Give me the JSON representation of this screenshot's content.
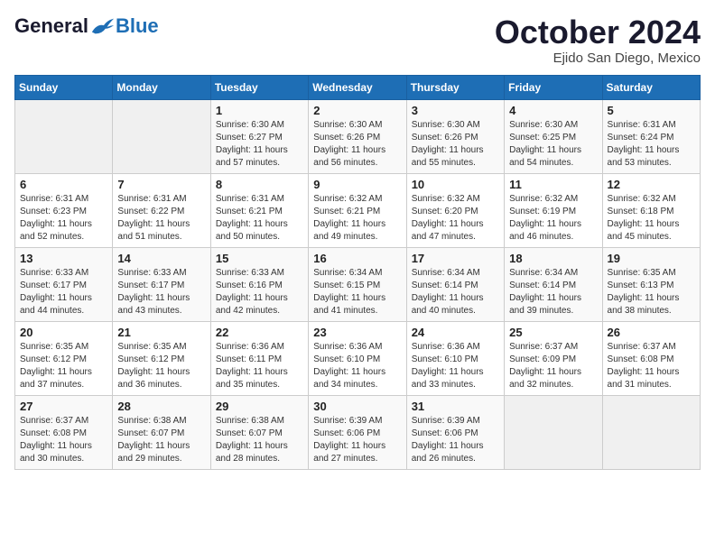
{
  "header": {
    "logo": {
      "general": "General",
      "blue": "Blue"
    },
    "title": "October 2024",
    "location": "Ejido San Diego, Mexico"
  },
  "weekdays": [
    "Sunday",
    "Monday",
    "Tuesday",
    "Wednesday",
    "Thursday",
    "Friday",
    "Saturday"
  ],
  "weeks": [
    [
      {
        "day": "",
        "info": ""
      },
      {
        "day": "",
        "info": ""
      },
      {
        "day": "1",
        "info": "Sunrise: 6:30 AM\nSunset: 6:27 PM\nDaylight: 11 hours and 57 minutes."
      },
      {
        "day": "2",
        "info": "Sunrise: 6:30 AM\nSunset: 6:26 PM\nDaylight: 11 hours and 56 minutes."
      },
      {
        "day": "3",
        "info": "Sunrise: 6:30 AM\nSunset: 6:26 PM\nDaylight: 11 hours and 55 minutes."
      },
      {
        "day": "4",
        "info": "Sunrise: 6:30 AM\nSunset: 6:25 PM\nDaylight: 11 hours and 54 minutes."
      },
      {
        "day": "5",
        "info": "Sunrise: 6:31 AM\nSunset: 6:24 PM\nDaylight: 11 hours and 53 minutes."
      }
    ],
    [
      {
        "day": "6",
        "info": "Sunrise: 6:31 AM\nSunset: 6:23 PM\nDaylight: 11 hours and 52 minutes."
      },
      {
        "day": "7",
        "info": "Sunrise: 6:31 AM\nSunset: 6:22 PM\nDaylight: 11 hours and 51 minutes."
      },
      {
        "day": "8",
        "info": "Sunrise: 6:31 AM\nSunset: 6:21 PM\nDaylight: 11 hours and 50 minutes."
      },
      {
        "day": "9",
        "info": "Sunrise: 6:32 AM\nSunset: 6:21 PM\nDaylight: 11 hours and 49 minutes."
      },
      {
        "day": "10",
        "info": "Sunrise: 6:32 AM\nSunset: 6:20 PM\nDaylight: 11 hours and 47 minutes."
      },
      {
        "day": "11",
        "info": "Sunrise: 6:32 AM\nSunset: 6:19 PM\nDaylight: 11 hours and 46 minutes."
      },
      {
        "day": "12",
        "info": "Sunrise: 6:32 AM\nSunset: 6:18 PM\nDaylight: 11 hours and 45 minutes."
      }
    ],
    [
      {
        "day": "13",
        "info": "Sunrise: 6:33 AM\nSunset: 6:17 PM\nDaylight: 11 hours and 44 minutes."
      },
      {
        "day": "14",
        "info": "Sunrise: 6:33 AM\nSunset: 6:17 PM\nDaylight: 11 hours and 43 minutes."
      },
      {
        "day": "15",
        "info": "Sunrise: 6:33 AM\nSunset: 6:16 PM\nDaylight: 11 hours and 42 minutes."
      },
      {
        "day": "16",
        "info": "Sunrise: 6:34 AM\nSunset: 6:15 PM\nDaylight: 11 hours and 41 minutes."
      },
      {
        "day": "17",
        "info": "Sunrise: 6:34 AM\nSunset: 6:14 PM\nDaylight: 11 hours and 40 minutes."
      },
      {
        "day": "18",
        "info": "Sunrise: 6:34 AM\nSunset: 6:14 PM\nDaylight: 11 hours and 39 minutes."
      },
      {
        "day": "19",
        "info": "Sunrise: 6:35 AM\nSunset: 6:13 PM\nDaylight: 11 hours and 38 minutes."
      }
    ],
    [
      {
        "day": "20",
        "info": "Sunrise: 6:35 AM\nSunset: 6:12 PM\nDaylight: 11 hours and 37 minutes."
      },
      {
        "day": "21",
        "info": "Sunrise: 6:35 AM\nSunset: 6:12 PM\nDaylight: 11 hours and 36 minutes."
      },
      {
        "day": "22",
        "info": "Sunrise: 6:36 AM\nSunset: 6:11 PM\nDaylight: 11 hours and 35 minutes."
      },
      {
        "day": "23",
        "info": "Sunrise: 6:36 AM\nSunset: 6:10 PM\nDaylight: 11 hours and 34 minutes."
      },
      {
        "day": "24",
        "info": "Sunrise: 6:36 AM\nSunset: 6:10 PM\nDaylight: 11 hours and 33 minutes."
      },
      {
        "day": "25",
        "info": "Sunrise: 6:37 AM\nSunset: 6:09 PM\nDaylight: 11 hours and 32 minutes."
      },
      {
        "day": "26",
        "info": "Sunrise: 6:37 AM\nSunset: 6:08 PM\nDaylight: 11 hours and 31 minutes."
      }
    ],
    [
      {
        "day": "27",
        "info": "Sunrise: 6:37 AM\nSunset: 6:08 PM\nDaylight: 11 hours and 30 minutes."
      },
      {
        "day": "28",
        "info": "Sunrise: 6:38 AM\nSunset: 6:07 PM\nDaylight: 11 hours and 29 minutes."
      },
      {
        "day": "29",
        "info": "Sunrise: 6:38 AM\nSunset: 6:07 PM\nDaylight: 11 hours and 28 minutes."
      },
      {
        "day": "30",
        "info": "Sunrise: 6:39 AM\nSunset: 6:06 PM\nDaylight: 11 hours and 27 minutes."
      },
      {
        "day": "31",
        "info": "Sunrise: 6:39 AM\nSunset: 6:06 PM\nDaylight: 11 hours and 26 minutes."
      },
      {
        "day": "",
        "info": ""
      },
      {
        "day": "",
        "info": ""
      }
    ]
  ]
}
